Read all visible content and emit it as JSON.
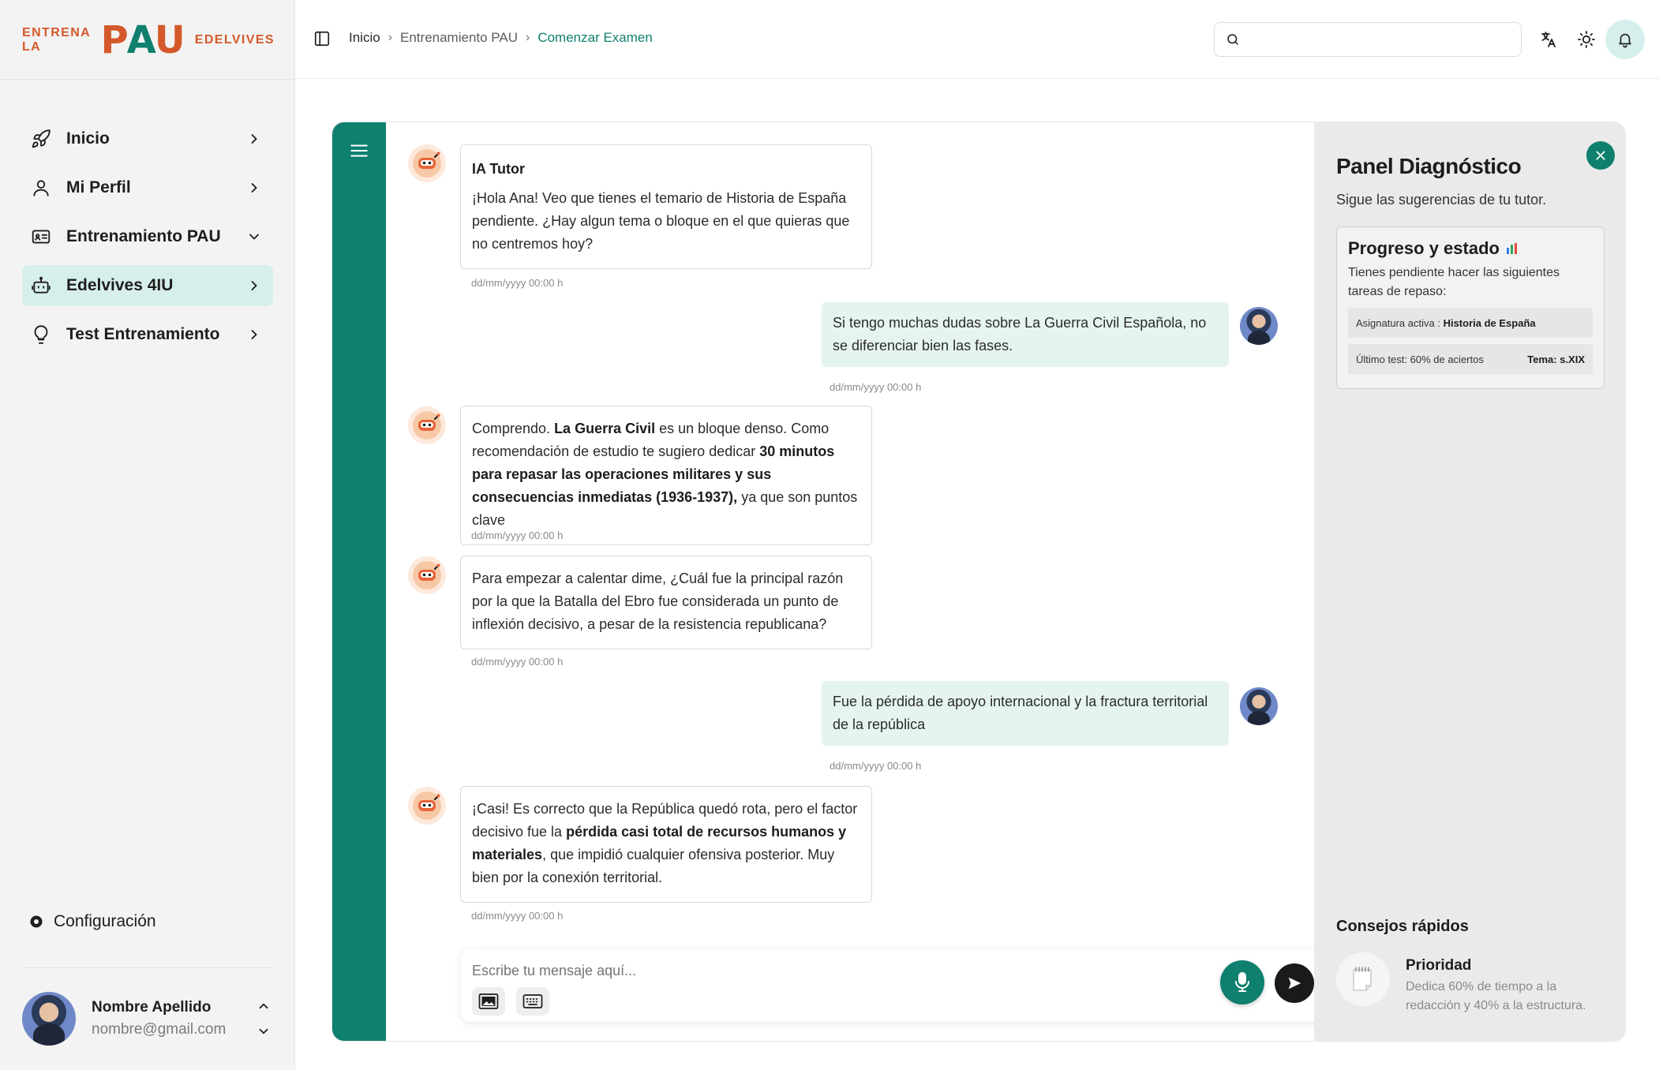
{
  "brand": {
    "left": "ENTRENA LA",
    "mark_p": "P",
    "mark_a": "A",
    "mark_u": "U",
    "right": "EDELVIVES"
  },
  "colors": {
    "accent": "#0f7f6e",
    "brand_orange": "#d4592a",
    "active_bg": "#d6efec",
    "user_bubble": "#e6f4f1"
  },
  "sidebar": {
    "items": [
      {
        "label": "Inicio",
        "icon": "rocket-icon",
        "chevron": "right"
      },
      {
        "label": "Mi Perfil",
        "icon": "user-icon",
        "chevron": "right"
      },
      {
        "label": "Entrenamiento PAU",
        "icon": "id-card-icon",
        "chevron": "down"
      },
      {
        "label": "Edelvives 4IU",
        "icon": "robot-icon",
        "chevron": "right",
        "active": true
      },
      {
        "label": "Test Entrenamiento",
        "icon": "lightbulb-icon",
        "chevron": "right"
      }
    ],
    "config_label": "Configuración",
    "user": {
      "name": "Nombre Apellido",
      "email": "nombre@gmail.com"
    }
  },
  "header": {
    "breadcrumb": [
      "Inicio",
      "Entrenamiento PAU",
      "Comenzar Examen"
    ],
    "search": {
      "value": "",
      "placeholder": ""
    }
  },
  "chat": {
    "messages": [
      {
        "role": "bot",
        "title": "IA Tutor",
        "text": "¡Hola Ana! Veo que tienes el temario de Historia de España pendiente. ¿Hay algun tema o bloque en el que quieras que no centremos hoy?",
        "time": "dd/mm/yyyy 00:00 h"
      },
      {
        "role": "user",
        "text": "Si tengo muchas dudas sobre La Guerra Civil Española, no se diferenciar bien las fases.",
        "time": "dd/mm/yyyy 00:00 h"
      },
      {
        "role": "bot",
        "parts": [
          "Comprendo. ",
          "La Guerra Civil",
          " es un bloque denso. Como recomendación de estudio te sugiero dedicar ",
          "30 minutos para repasar las operaciones militares y sus consecuencias inmediatas (1936-1937),",
          " ya que son puntos clave"
        ],
        "time": "dd/mm/yyyy 00:00 h"
      },
      {
        "role": "bot",
        "text": "Para empezar a calentar dime, ¿Cuál fue la principal razón por la que la Batalla del Ebro fue considerada un punto de inflexión decisivo, a pesar de la resistencia republicana?",
        "time": "dd/mm/yyyy 00:00 h"
      },
      {
        "role": "user",
        "text": "Fue la pérdida de apoyo internacional y la fractura territorial de la república",
        "time": "dd/mm/yyyy 00:00 h"
      },
      {
        "role": "bot",
        "parts": [
          "¡Casi! Es correcto que la República quedó rota, pero el factor decisivo fue la ",
          "pérdida casi total de recursos humanos y materiales",
          ", que impidió cualquier ofensiva posterior. Muy bien por la conexión territorial."
        ],
        "time": "dd/mm/yyyy 00:00 h"
      }
    ],
    "composer": {
      "placeholder": "Escribe tu mensaje aquí..."
    }
  },
  "diagnostic": {
    "title": "Panel Diagnóstico",
    "subtitle": "Sigue las sugerencias de tu tutor.",
    "progress": {
      "title": "Progreso y estado",
      "desc": "Tienes pendiente hacer las siguientes tareas de repaso:",
      "subject_label": "Asignatura activa : ",
      "subject_value": "Historia de España",
      "last_test": "Último test: 60% de aciertos",
      "topic": "Tema: s.XIX"
    },
    "tips_title": "Consejos rápidos",
    "tip": {
      "title": "Prioridad",
      "text": "Dedica 60% de tiempo a la redacción y 40% a la estructura."
    }
  }
}
